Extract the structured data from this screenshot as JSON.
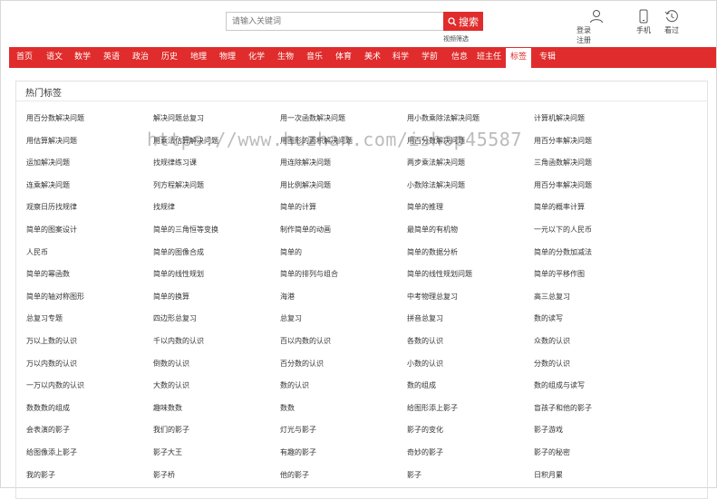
{
  "search": {
    "placeholder": "请输入关键词",
    "button_label": "搜索",
    "sub_link": "视频筛选"
  },
  "top_icons": [
    {
      "name": "user-icon",
      "label_lines": [
        "登录",
        "注册"
      ]
    },
    {
      "name": "phone-icon",
      "label_lines": [
        "手机"
      ]
    },
    {
      "name": "history-icon",
      "label_lines": [
        "看过"
      ]
    }
  ],
  "nav": {
    "items": [
      "首页",
      "语文",
      "数学",
      "英语",
      "政治",
      "历史",
      "地理",
      "物理",
      "化学",
      "生物",
      "音乐",
      "体育",
      "美术",
      "科学",
      "学前",
      "信息",
      "班主任",
      "标签",
      "专辑"
    ],
    "active": "标签"
  },
  "panel": {
    "title": "热门标签",
    "rows": [
      [
        "用百分数解决问题",
        "解决问题总复习",
        "用一次函数解决问题",
        "用小数乘除法解决问题",
        "计算机解决问题"
      ],
      [
        "用估算解决问题",
        "用乘法估算解决问题",
        "用图形的面积解决问题",
        "用百分数解决问题",
        "用百分率解决问题"
      ],
      [
        "运加解决问题",
        "找规律练习课",
        "用连除解决问题",
        "两步乘法解决问题",
        "三角函数解决问题"
      ],
      [
        "连乘解决问题",
        "列方程解决问题",
        "用比例解决问题",
        "小数除法解决问题",
        "用百分率解决问题"
      ],
      [
        "观察日历找规律",
        "找规律",
        "简单的计算",
        "简单的推理",
        "简单的概率计算"
      ],
      [
        "简单的图案设计",
        "简单的三角恒等变换",
        "制作简单的动画",
        "最简单的有机物",
        "一元以下的人民币"
      ],
      [
        "人民币",
        "简单的图像合成",
        "简单的",
        "简单的数据分析",
        "简单的分数加减法"
      ],
      [
        "简单的幂函数",
        "简单的线性规划",
        "简单的排列与组合",
        "简单的线性规划问题",
        "简单的平移作图"
      ],
      [
        "简单的轴对称图形",
        "简单的换算",
        "海港",
        "中考物理总复习",
        "高三总复习"
      ],
      [
        "总复习专题",
        "四边形总复习",
        "总复习",
        "拼音总复习",
        "数的读写"
      ],
      [
        "万以上数的认识",
        "千以内数的认识",
        "百以内数的认识",
        "各数的认识",
        "众数的认识"
      ],
      [
        "万以内数的认识",
        "倒数的认识",
        "百分数的认识",
        "小数的认识",
        "分数的认识"
      ],
      [
        "一万以内数的认识",
        "大数的认识",
        "数的认识",
        "数的组成",
        "数的组成与读写"
      ],
      [
        "数数数的组成",
        "趣味数数",
        "数数",
        "给图形添上影子",
        "盲孩子和他的影子"
      ],
      [
        "会表演的影子",
        "我们的影子",
        "灯光与影子",
        "影子的变化",
        "影子游戏"
      ],
      [
        "给图像添上影子",
        "影子大王",
        "有趣的影子",
        "奇妙的影子",
        "影子的秘密"
      ],
      [
        "我的影子",
        "影子桥",
        "他的影子",
        "影子",
        "日积月累"
      ]
    ]
  },
  "watermark": "https://www.huzhan.com/ishop45587",
  "colors": {
    "accent": "#e02c2c"
  }
}
